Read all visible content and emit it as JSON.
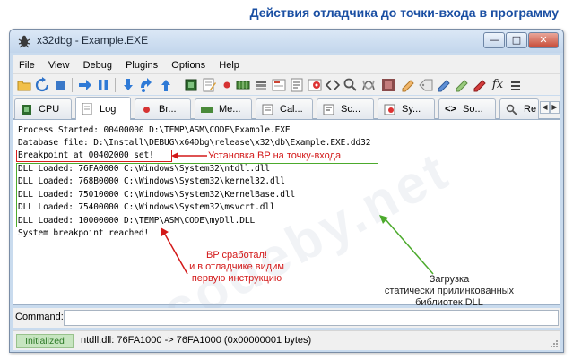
{
  "heading": "Действия отладчика до точки-входа в программу",
  "window": {
    "title": "x32dbg - Example.EXE"
  },
  "menu": [
    "File",
    "View",
    "Debug",
    "Plugins",
    "Options",
    "Help"
  ],
  "toolbar_icons": [
    "open-folder-icon",
    "restart-icon",
    "close-icon",
    "run-icon",
    "pause-icon",
    "step-into-icon",
    "step-over-icon",
    "execute-till-return-icon",
    "cpu-chip-icon",
    "notes-icon",
    "breakpoint-icon",
    "memory-map-icon",
    "call-stack-icon",
    "seh-icon",
    "script-icon",
    "symbols-icon",
    "source-icon",
    "references-icon",
    "threads-icon",
    "patches-icon",
    "comments-icon",
    "labels-icon",
    "bookmarks-icon",
    "functions-icon"
  ],
  "tabs": [
    "CPU",
    "Log",
    "Br...",
    "Me...",
    "Cal...",
    "Sc...",
    "Sy...",
    "So...",
    "Re"
  ],
  "log": {
    "lines": [
      "Process Started: 00400000 D:\\TEMP\\ASM\\CODE\\Example.EXE",
      "Database file: D:\\Install\\DEBUG\\x64Dbg\\release\\x32\\db\\Example.EXE.dd32",
      "Breakpoint at 00402000 set!",
      "DLL Loaded: 76FA0000 C:\\Windows\\System32\\ntdll.dll",
      "DLL Loaded: 768B0000 C:\\Windows\\System32\\kernel32.dll",
      "DLL Loaded: 75010000 C:\\Windows\\System32\\KernelBase.dll",
      "DLL Loaded: 75400000 C:\\Windows\\System32\\msvcrt.dll",
      "DLL Loaded: 10000000 D:\\TEMP\\ASM\\CODE\\myDll.DLL",
      "System breakpoint reached!"
    ]
  },
  "annotations": {
    "bp_set": "Установка BP на точку-входа",
    "bp_hit": [
      "BP сработал!",
      "и в отладчике видим",
      "первую инструкцию"
    ],
    "static_libs": [
      "Загрузка",
      "статически прилинкованных",
      "библиотек DLL"
    ]
  },
  "command": {
    "label": "Command:",
    "value": ""
  },
  "status": {
    "badge": "Initialized",
    "text": "ntdll.dll: 76FA1000 -> 76FA1000 (0x00000001 bytes)"
  },
  "colors": {
    "annotation_red": "#d31818",
    "annotation_green": "#4caa2c",
    "status_green": "#c7e5c0",
    "heading_blue": "#1a4fa3"
  }
}
